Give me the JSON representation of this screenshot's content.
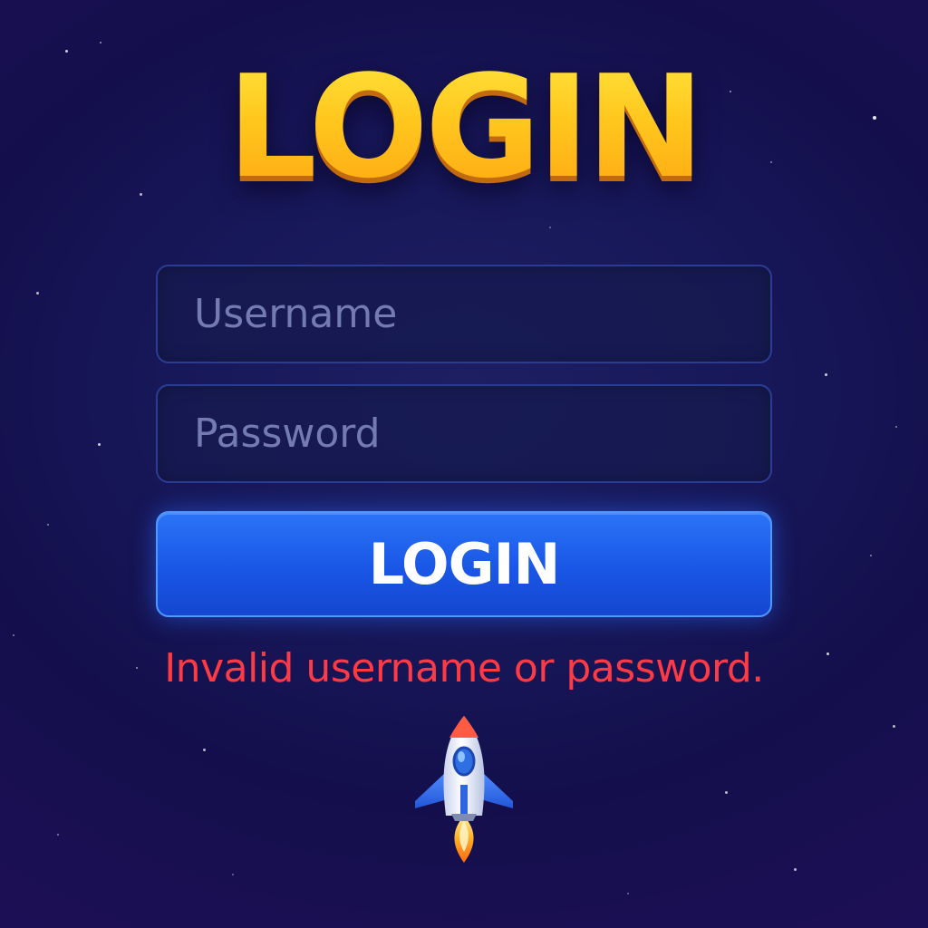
{
  "title": "LOGIN",
  "form": {
    "username_placeholder": "Username",
    "password_placeholder": "Password",
    "submit_label": "LOGIN"
  },
  "error_message": "Invalid username or password.",
  "colors": {
    "background": "#17185a",
    "title_gold": "#ffc21a",
    "button_blue": "#1a56e6",
    "error_red": "#ff3a45"
  },
  "icons": {
    "decoration": "rocket-icon"
  }
}
